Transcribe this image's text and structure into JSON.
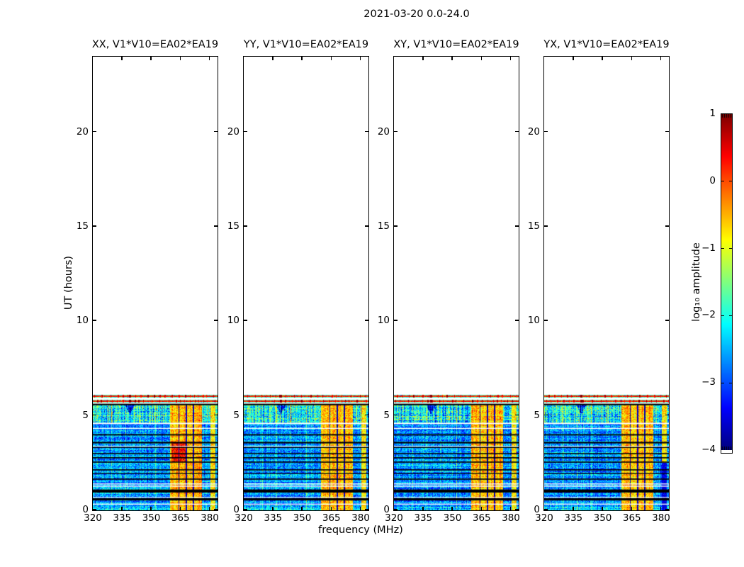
{
  "chart_data": {
    "type": "heatmap",
    "title": "2021-03-20 0.0-24.0",
    "xlabel": "frequency (MHz)",
    "ylabel": "UT (hours)",
    "panels": [
      {
        "label": "XX, V1*V10=EA02*EA19",
        "seed": 11,
        "hot": true,
        "right_dark": false
      },
      {
        "label": "YY, V1*V10=EA02*EA19",
        "seed": 27,
        "hot": false,
        "right_dark": false
      },
      {
        "label": "XY, V1*V10=EA02*EA19",
        "seed": 43,
        "hot": false,
        "right_dark": false
      },
      {
        "label": "YX, V1*V10=EA02*EA19",
        "seed": 59,
        "hot": false,
        "right_dark": true
      }
    ],
    "x_range": [
      320,
      384
    ],
    "x_ticks": [
      320,
      335,
      350,
      365,
      380
    ],
    "x_tick_labels": [
      "320",
      "335",
      "350",
      "365",
      "380"
    ],
    "y_range": [
      0,
      24
    ],
    "y_ticks": [
      0,
      5,
      10,
      15,
      20
    ],
    "y_tick_labels": [
      "0",
      "5",
      "10",
      "15",
      "20"
    ],
    "colorbar": {
      "label": "log₁₀ amplitude",
      "range": [
        -4,
        1
      ],
      "ticks": [
        1,
        0,
        -1,
        -2,
        -3,
        -4
      ],
      "tick_labels": [
        "1",
        "0",
        "−1",
        "−2",
        "−3",
        "−4"
      ],
      "colormap": "jet"
    },
    "data": {
      "main_block_ut": [
        0,
        5.59
      ],
      "bright_block_ut": [
        4.62,
        5.59
      ],
      "cal_rows_ut": [
        [
          5.7,
          5.85
        ],
        [
          5.955,
          6.1
        ]
      ],
      "background_amp": -2.65,
      "bright_amp": -2.1,
      "cal_amp": -1.85,
      "rfi_band_main": {
        "f": [
          359.5,
          376.0
        ],
        "amp": -0.55
      },
      "rfi_band_right": {
        "f": [
          380.3,
          383.0
        ],
        "amp": -0.78
      },
      "flagged_channels_mhz": [
        364.2,
        368.0,
        371.6
      ],
      "narrow_rfi_mhz": [
        329.5,
        336.8,
        344.2,
        352.3
      ],
      "notch_mhz": 339.0,
      "hot_region": {
        "ut": [
          2.55,
          3.65
        ],
        "f": [
          360.5,
          367.5
        ],
        "amp": 0.3
      },
      "black_stripes_ut": [
        [
          5.56,
          5.64
        ],
        [
          3.96,
          4.03
        ],
        [
          3.54,
          3.62
        ],
        [
          3.3,
          3.35
        ],
        [
          2.97,
          3.03
        ],
        [
          2.75,
          2.81
        ],
        [
          2.52,
          2.58
        ],
        [
          2.11,
          2.17
        ],
        [
          1.92,
          1.97
        ],
        [
          1.62,
          1.68
        ],
        [
          0.94,
          1.1
        ],
        [
          0.52,
          0.64
        ]
      ],
      "white_stripes_ut": [
        [
          4.56,
          4.63
        ],
        [
          4.31,
          4.36
        ],
        [
          3.37,
          3.41
        ],
        [
          1.37,
          1.42
        ],
        [
          1.25,
          1.3
        ],
        [
          0.67,
          0.71
        ],
        [
          0.3,
          0.35
        ]
      ]
    }
  }
}
